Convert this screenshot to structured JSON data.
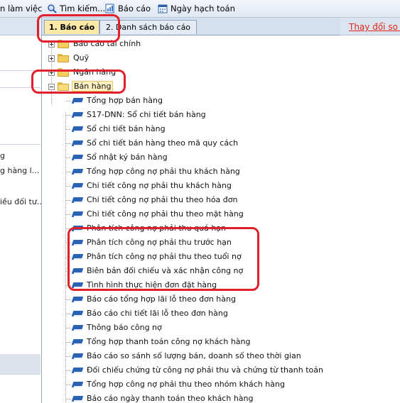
{
  "toolbar": {
    "items": [
      {
        "label": "n làm việc",
        "icon": "workspace-icon"
      },
      {
        "label": "Tìm kiếm...",
        "icon": "search-icon"
      },
      {
        "label": "Báo cáo",
        "icon": "report-icon"
      },
      {
        "label": "Ngày hạch toán",
        "icon": "calendar-icon"
      }
    ]
  },
  "left_panel": {
    "items": [
      "g",
      "g hàng l...",
      "iều đối tư..."
    ]
  },
  "tabs": [
    {
      "label": "1. Báo cáo",
      "active": true
    },
    {
      "label": "2. Danh sách báo cáo",
      "active": false
    }
  ],
  "tree": {
    "folders": [
      {
        "label": "Báo cáo tài chính"
      },
      {
        "label": "Quỹ"
      },
      {
        "label": "Ngân hàng"
      },
      {
        "label": "Bán hàng"
      }
    ],
    "reports": [
      "Tổng hợp bán hàng",
      "S17-DNN: Sổ chi tiết bán hàng",
      "Sổ chi tiết bán hàng",
      "Sổ chi tiết bán hàng theo mã quy cách",
      "Sổ nhật ký bán hàng",
      "Tổng hợp công nợ phải thu khách hàng",
      "Chi tiết công nợ phải thu khách hàng",
      "Chi tiết công nợ phải thu theo hóa đơn",
      "Chi tiết công nợ phải thu theo mặt hàng",
      "Phân tích công nợ phải thu quá hạn",
      "Phân tích công nợ phải thu trước hạn",
      "Phân tích công nợ phải thu theo tuổi nợ",
      "Biên bản đối chiếu và xác nhận công nợ",
      "Tình hình thực hiện đơn đặt hàng",
      "Báo cáo tổng hợp lãi lỗ theo đơn hàng",
      "Báo cáo chi tiết lãi lỗ theo đơn hàng",
      "Thông báo công nợ",
      "Tổng hợp thanh toán công nợ khách hàng",
      "Báo cáo so sánh số lượng bán, doanh số theo thời gian",
      "Đối chiếu chứng từ công nợ phải thu và chứng từ thanh toán",
      "Tổng hợp công nợ phải thu theo nhóm khách hàng",
      "Báo cáo ngày thanh toán theo khách hàng"
    ]
  },
  "right_panel": {
    "link": "Thay đổi so với"
  },
  "colors": {
    "annotation": "#e0202a",
    "link": "#e2231a",
    "active_tab": "#fde9a6"
  }
}
